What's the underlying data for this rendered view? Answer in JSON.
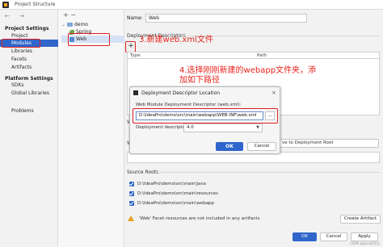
{
  "window": {
    "title": "Project Structure"
  },
  "nav_arrows": "←  →",
  "sidebar": {
    "project_settings_header": "Project Settings",
    "project_items": [
      "Project",
      "Modules",
      "Libraries",
      "Facets",
      "Artifacts"
    ],
    "platform_settings_header": "Platform Settings",
    "platform_items": [
      "SDKs",
      "Global Libraries"
    ],
    "problems": "Problems"
  },
  "tree": {
    "toolbar": "+ −",
    "root": "demo",
    "children": [
      "Spring",
      "Web"
    ]
  },
  "main": {
    "name_label": "Name:",
    "name_value": "Web",
    "deployment_descriptors": "Deployment Descriptors",
    "add_button": "+",
    "table_col_type": "Type",
    "table_col_path": "Path",
    "truncated_label_1": "W",
    "truncated_label_2": "W",
    "add_root_button": "ve to Deployment Root",
    "source_roots_label": "Source Roots",
    "source_roots": [
      "D:\\IdeaPro\\demo\\src\\main\\java",
      "D:\\IdeaPro\\demo\\src\\main\\resources",
      "D:\\IdeaPro\\demo\\src\\main\\webapp"
    ],
    "warning": "'Web' Facet resources are not included in any artifacts",
    "create_artifact": "Create Artifact"
  },
  "footer": {
    "ok": "OK",
    "cancel": "Cancel",
    "apply": "Apply"
  },
  "dialog": {
    "title": "Deployment Descriptor Location",
    "close": "×",
    "path_label": "Web Module Deployment Descriptor (web.xml):",
    "path_value": "D:\\IdeaPro\\demo\\src\\main\\webapp\\WEB-INF\\web.xml",
    "browse": "…",
    "version_label": "Deployment descriptor version",
    "version_value": "4.0",
    "ok": "OK",
    "cancel": "Cancel"
  },
  "annotations": {
    "step3": "3.新建web.xml文件",
    "step4": "4.选择刚刚新建的webapp文件夹，添加如下路径"
  },
  "watermark": "CSDN @Java程序员",
  "colors": {
    "accent": "#2f65ca",
    "annotation": "#e8231b",
    "warning": "#e5a21f"
  }
}
